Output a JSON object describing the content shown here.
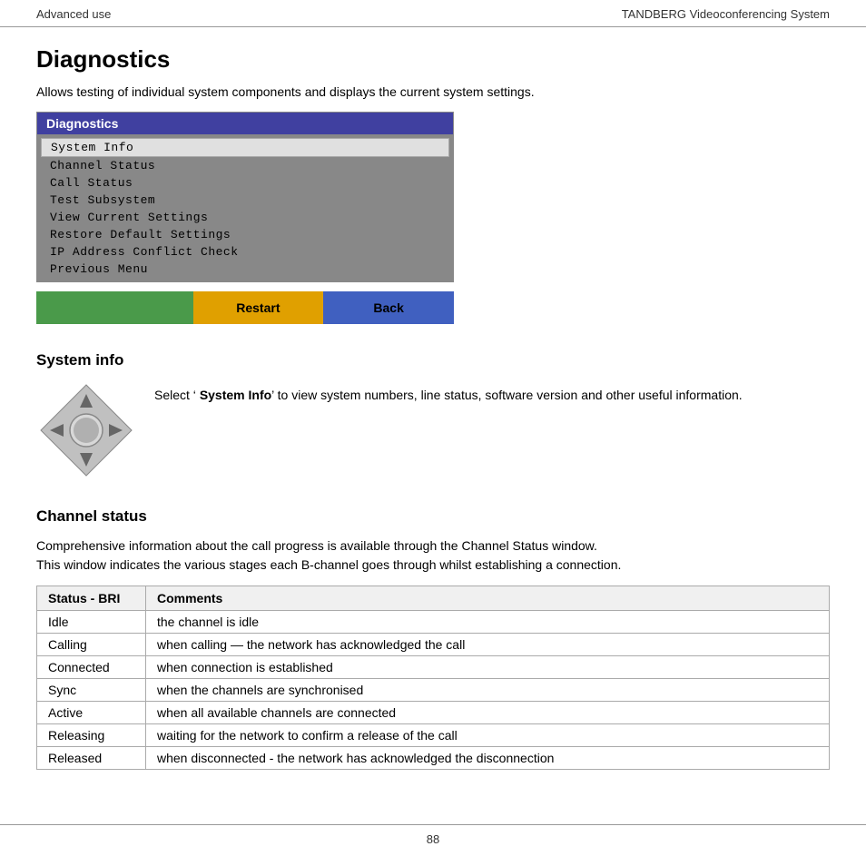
{
  "header": {
    "left": "Advanced use",
    "right": "TANDBERG Videoconferencing System"
  },
  "page": {
    "title": "Diagnostics",
    "description": "Allows testing of individual system components and displays the current system settings."
  },
  "menu": {
    "header": "Diagnostics",
    "items": [
      {
        "label": "System Info",
        "selected": true
      },
      {
        "label": "Channel Status",
        "selected": false
      },
      {
        "label": "Call Status",
        "selected": false
      },
      {
        "label": "Test Subsystem",
        "selected": false
      },
      {
        "label": "View Current Settings",
        "selected": false
      },
      {
        "label": "Restore Default Settings",
        "selected": false
      },
      {
        "label": "IP Address Conflict Check",
        "selected": false
      },
      {
        "label": "Previous Menu",
        "selected": false
      }
    ]
  },
  "buttons": {
    "restart": "Restart",
    "back": "Back"
  },
  "system_info": {
    "heading": "System info",
    "text_before": "Select ‘ ",
    "text_bold": "System Info",
    "text_after": "’ to view system numbers, line status, software version and other useful information."
  },
  "channel_status": {
    "heading": "Channel status",
    "description_line1": "Comprehensive information about the call progress is available through the Channel Status window.",
    "description_line2": "This window indicates the various stages each B-channel goes through whilst establishing a connection.",
    "table_headers": [
      "Status - BRI",
      "Comments"
    ],
    "table_rows": [
      {
        "status": "Idle",
        "comment": "the channel is idle"
      },
      {
        "status": "Calling",
        "comment": "when calling — the network has acknowledged the call"
      },
      {
        "status": "Connected",
        "comment": "when connection is established"
      },
      {
        "status": "Sync",
        "comment": "when the channels are synchronised"
      },
      {
        "status": "Active",
        "comment": "when all available channels are connected"
      },
      {
        "status": "Releasing",
        "comment": "waiting for the network to confirm a release of the call"
      },
      {
        "status": "Released",
        "comment": "when disconnected - the network has acknowledged the disconnection"
      }
    ]
  },
  "footer": {
    "page_number": "88"
  }
}
